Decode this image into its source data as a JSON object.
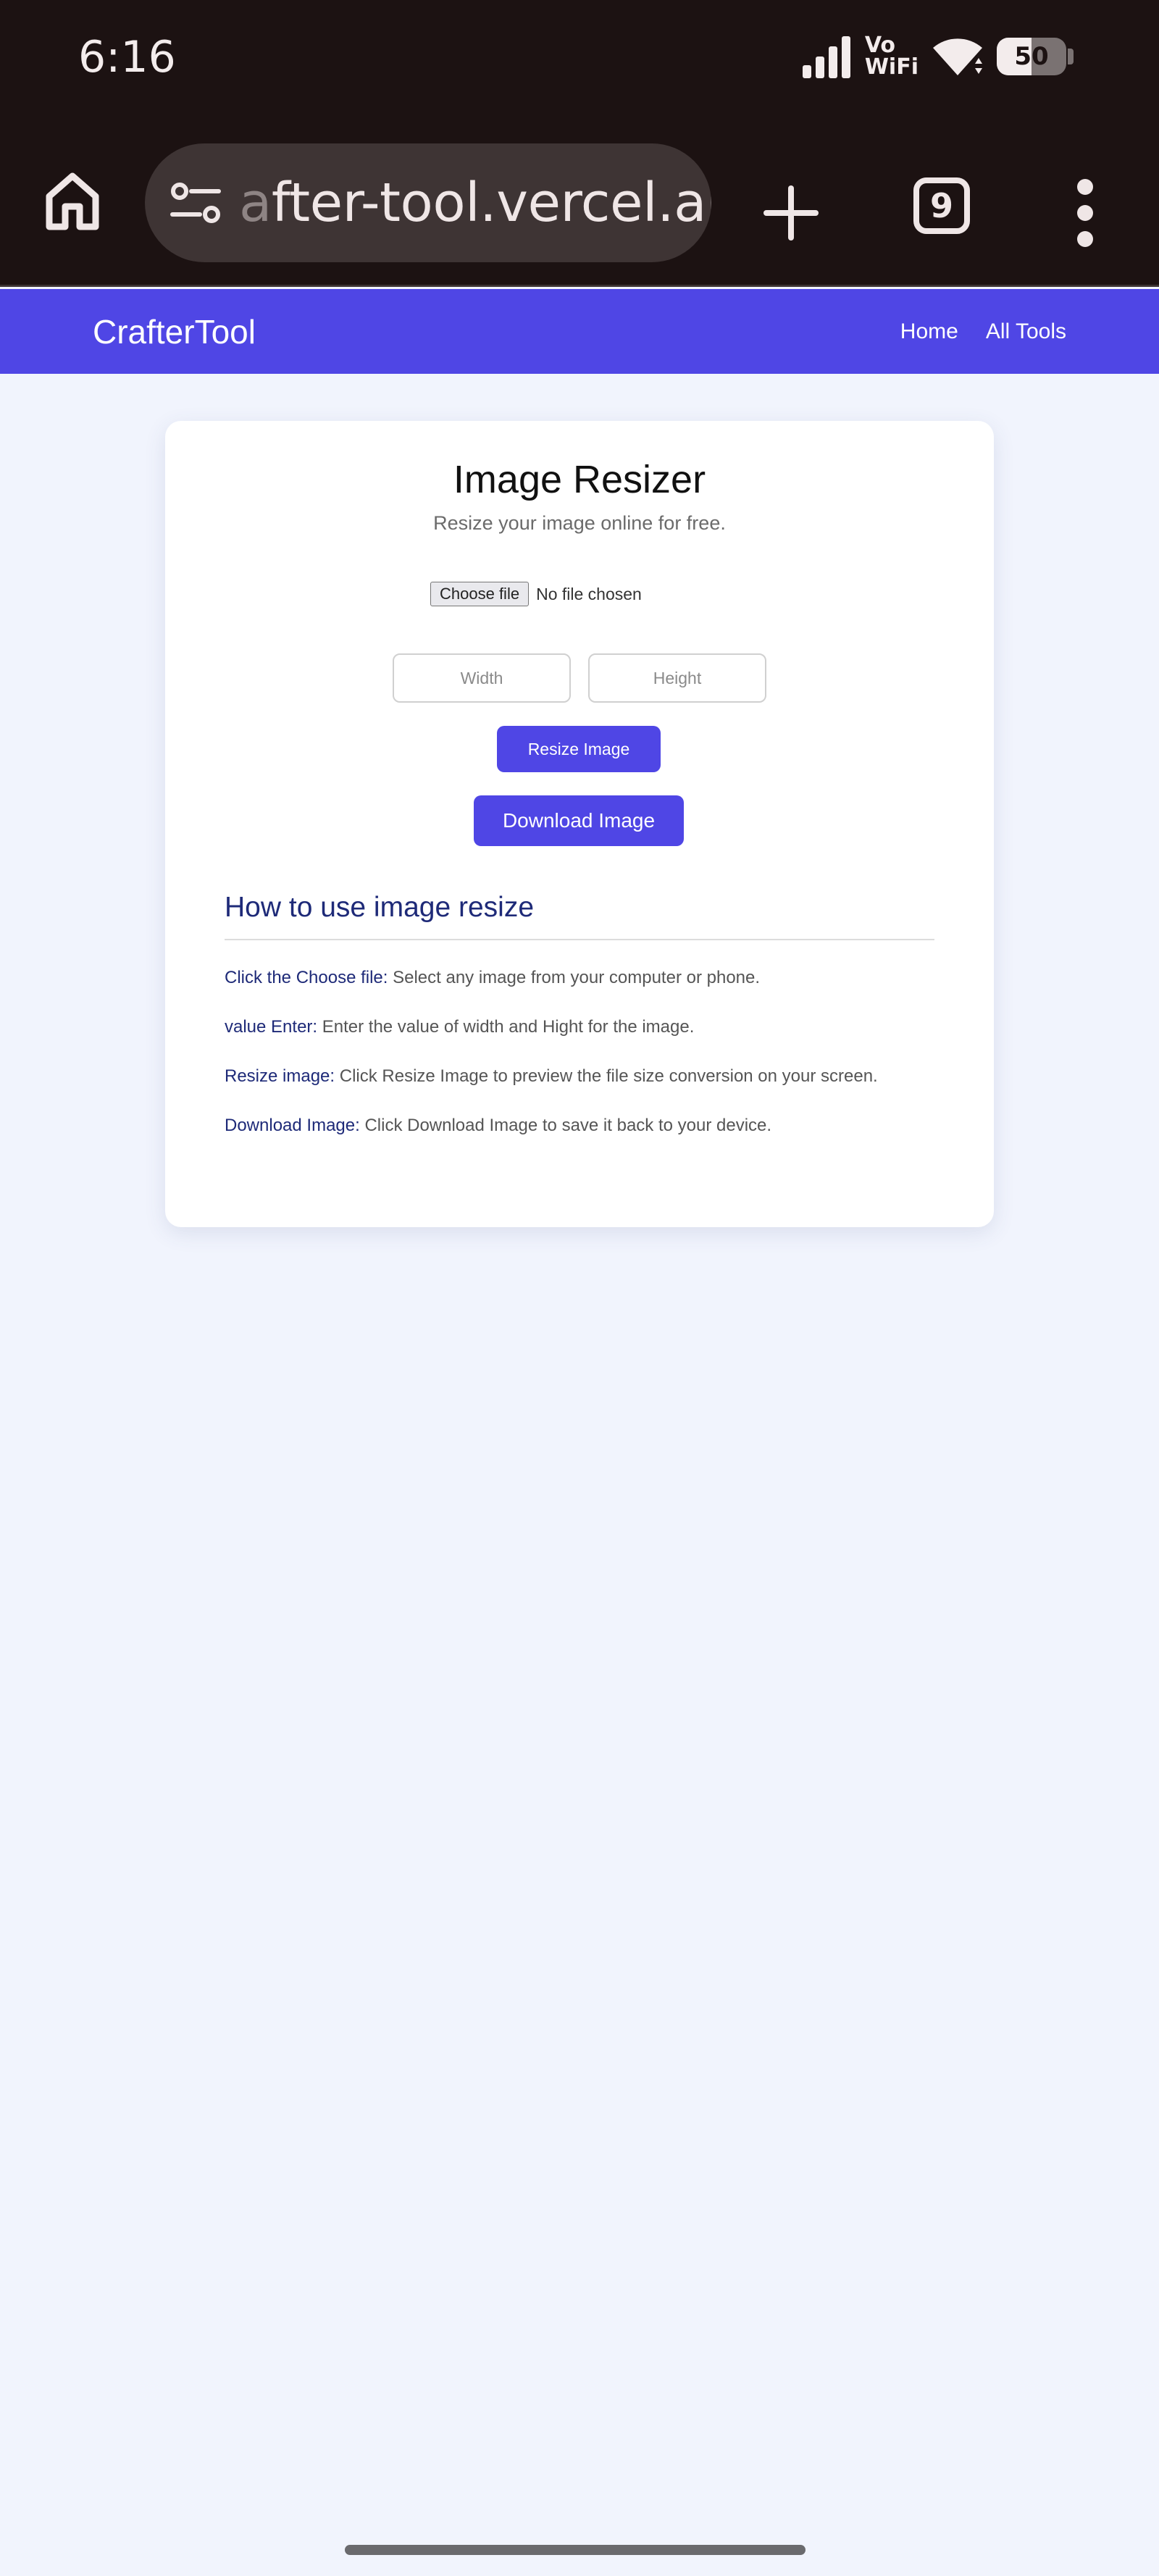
{
  "status_bar": {
    "time": "6:16",
    "network_label_top": "Vo",
    "network_label_bottom": "WiFi",
    "battery_percent": "50"
  },
  "browser": {
    "url_faded_prefix": "a",
    "url": "fter-tool.vercel.app",
    "tab_count": "9",
    "colors": {
      "bar": "#1c1212",
      "pill": "#3e3434"
    }
  },
  "site": {
    "brand": "CrafterTool",
    "nav": [
      "Home",
      "All Tools"
    ],
    "accent_color": "#4f46e5"
  },
  "tool": {
    "title": "Image Resizer",
    "subtitle": "Resize your image online for free.",
    "file_button": "Choose file",
    "file_status": "No file chosen",
    "width_placeholder": "Width",
    "height_placeholder": "Height",
    "resize_button": "Resize Image",
    "download_button": "Download Image"
  },
  "howto": {
    "title": "How to use image resize",
    "steps": [
      {
        "key": "Click the Choose file:",
        "text": " Select any image from your computer or phone."
      },
      {
        "key": "value Enter:",
        "text": " Enter the value of width and Hight for the image."
      },
      {
        "key": "Resize image:",
        "text": " Click Resize Image to preview the file size conversion on your screen."
      },
      {
        "key": "Download Image:",
        "text": " Click Download Image to save it back to your device."
      }
    ]
  }
}
